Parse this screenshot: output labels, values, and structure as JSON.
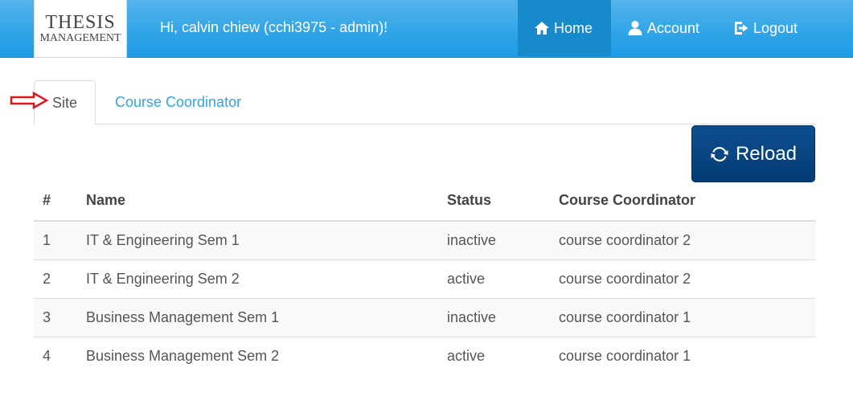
{
  "brand": {
    "line1": "THESIS",
    "line2": "MANAGEMENT"
  },
  "greeting": "Hi, calvin chiew (cchi3975 - admin)!",
  "nav": {
    "home": "Home",
    "account": "Account",
    "logout": "Logout"
  },
  "tabs": {
    "site": "Site",
    "course_coordinator": "Course Coordinator"
  },
  "reload_label": "Reload",
  "table": {
    "headers": [
      "#",
      "Name",
      "Status",
      "Course Coordinator"
    ],
    "rows": [
      {
        "num": "1",
        "name": "IT & Engineering Sem 1",
        "status": "inactive",
        "coordinator": "course coordinator 2"
      },
      {
        "num": "2",
        "name": "IT & Engineering Sem 2",
        "status": "active",
        "coordinator": "course coordinator 2"
      },
      {
        "num": "3",
        "name": "Business Management Sem 1",
        "status": "inactive",
        "coordinator": "course coordinator 1"
      },
      {
        "num": "4",
        "name": "Business Management Sem 2",
        "status": "active",
        "coordinator": "course coordinator 1"
      }
    ]
  },
  "colors": {
    "navbar": "#2fa4e7",
    "nav_active": "#178acc",
    "primary_button": "#033c73",
    "link": "#2fa4e7",
    "annotation_arrow": "#e0161b"
  },
  "icons": {
    "home": "home-icon",
    "account": "user-icon",
    "logout": "logout-icon",
    "reload": "refresh-icon",
    "annotation": "arrow-right-icon"
  }
}
